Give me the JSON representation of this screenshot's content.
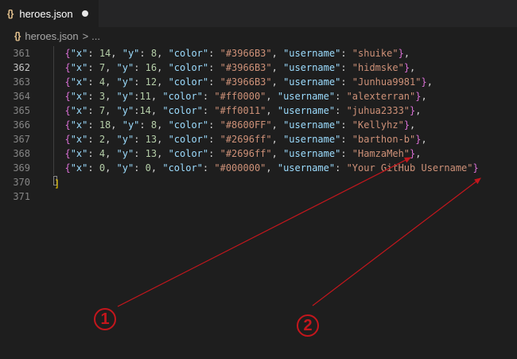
{
  "tab": {
    "icon": "{}",
    "label": "heroes.json",
    "dirty_indicator": "unsaved-dot"
  },
  "breadcrumb": {
    "icon": "{}",
    "file": "heroes.json",
    "separator": ">",
    "more": "..."
  },
  "editor": {
    "active_line": 362,
    "lines": [
      {
        "num": 361,
        "x": "14",
        "y": "8",
        "color": "#3966B3",
        "username": "shuike",
        "trail": "},"
      },
      {
        "num": 362,
        "x": "7",
        "y": "16",
        "color": "#3966B3",
        "username": "hidmske",
        "trail": "},"
      },
      {
        "num": 363,
        "x": "4",
        "y": "12",
        "color": "#3966B3",
        "username": "Junhua9981",
        "trail": "},"
      },
      {
        "num": 364,
        "x": "3",
        "y": "11",
        "color": "#ff0000",
        "username": "alexterran",
        "trail": "},"
      },
      {
        "num": 365,
        "x": "7",
        "y": "14",
        "color": "#ff0011",
        "username": "juhua2333",
        "trail": "},"
      },
      {
        "num": 366,
        "x": "18",
        "y": "8",
        "color": "#8600FF",
        "username": "Kellyhz",
        "trail": "},"
      },
      {
        "num": 367,
        "x": "2",
        "y": "13",
        "color": "#2696ff",
        "username": "barthon-b",
        "trail": "},"
      },
      {
        "num": 368,
        "x": "4",
        "y": "13",
        "color": "#2696ff",
        "username": "HamzaMeh",
        "trail": "},"
      },
      {
        "num": 369,
        "x": "0",
        "y": "0",
        "color": "#000000",
        "username": "Your GitHub Username",
        "trail": "}"
      }
    ],
    "closing_line": {
      "num": 370,
      "text": "]"
    },
    "empty_line": {
      "num": 371
    }
  },
  "annotations": [
    {
      "label": "1"
    },
    {
      "label": "2"
    }
  ],
  "colors": {
    "annotation": "#c4161c",
    "brace": "#da70d6",
    "bracket": "#ffd700",
    "key": "#9cdcfe",
    "string": "#ce9178",
    "number": "#b5cea8"
  }
}
